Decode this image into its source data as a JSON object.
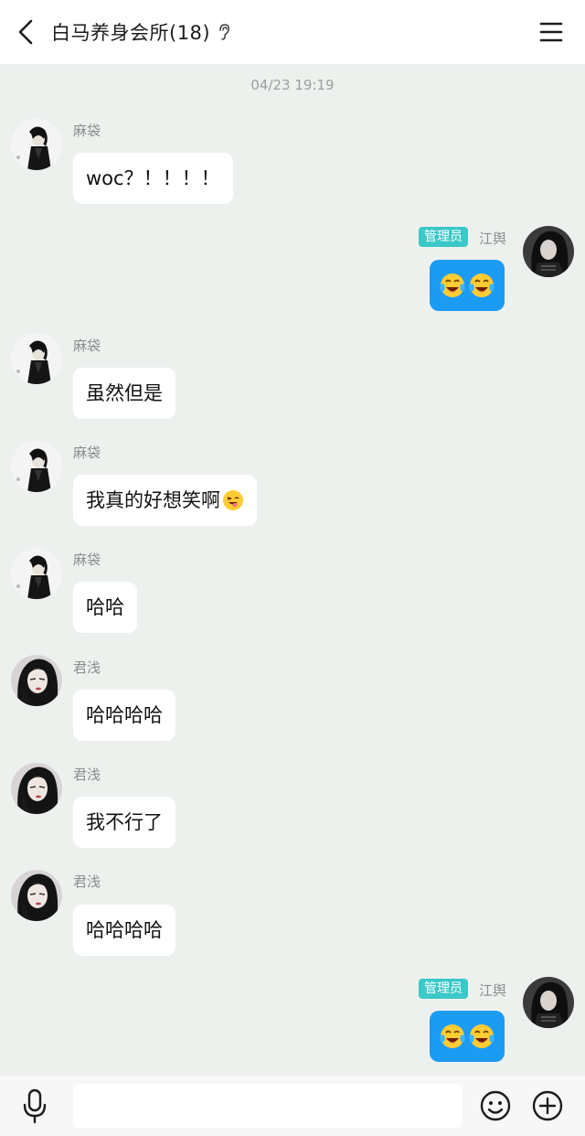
{
  "header": {
    "title": "白马养身会所(18)",
    "back_icon": "chevron-left-icon",
    "ear_icon": "ear-icon",
    "menu_icon": "hamburger-menu-icon"
  },
  "timestamp": "04/23 19:19",
  "admin_label": "管理员",
  "messages": [
    {
      "sender": "麻袋",
      "text": "woc？！！！！",
      "side": "left"
    },
    {
      "sender": "江舆",
      "side": "right",
      "admin": true,
      "emojis": [
        "crying-laughing-emoji",
        "crying-laughing-emoji"
      ]
    },
    {
      "sender": "麻袋",
      "text": "虽然但是",
      "side": "left"
    },
    {
      "sender": "麻袋",
      "text": "我真的好想笑啊",
      "side": "left",
      "trailing_emoji": "tongue-wink-emoji"
    },
    {
      "sender": "麻袋",
      "text": "哈哈",
      "side": "left"
    },
    {
      "sender": "君浅",
      "text": "哈哈哈哈",
      "side": "left"
    },
    {
      "sender": "君浅",
      "text": "我不行了",
      "side": "left"
    },
    {
      "sender": "君浅",
      "text": "哈哈哈哈",
      "side": "left"
    },
    {
      "sender": "江舆",
      "side": "right",
      "admin": true,
      "emojis": [
        "crying-laughing-emoji",
        "crying-laughing-emoji"
      ]
    }
  ],
  "input_bar": {
    "value": "",
    "placeholder": "",
    "mic_icon": "microphone-icon",
    "emoji_icon": "smiley-icon",
    "plus_icon": "plus-circle-icon"
  },
  "colors": {
    "admin_badge": "#3cc8c8",
    "my_bubble": "#1c9bf5",
    "background": "#edf1ee"
  }
}
